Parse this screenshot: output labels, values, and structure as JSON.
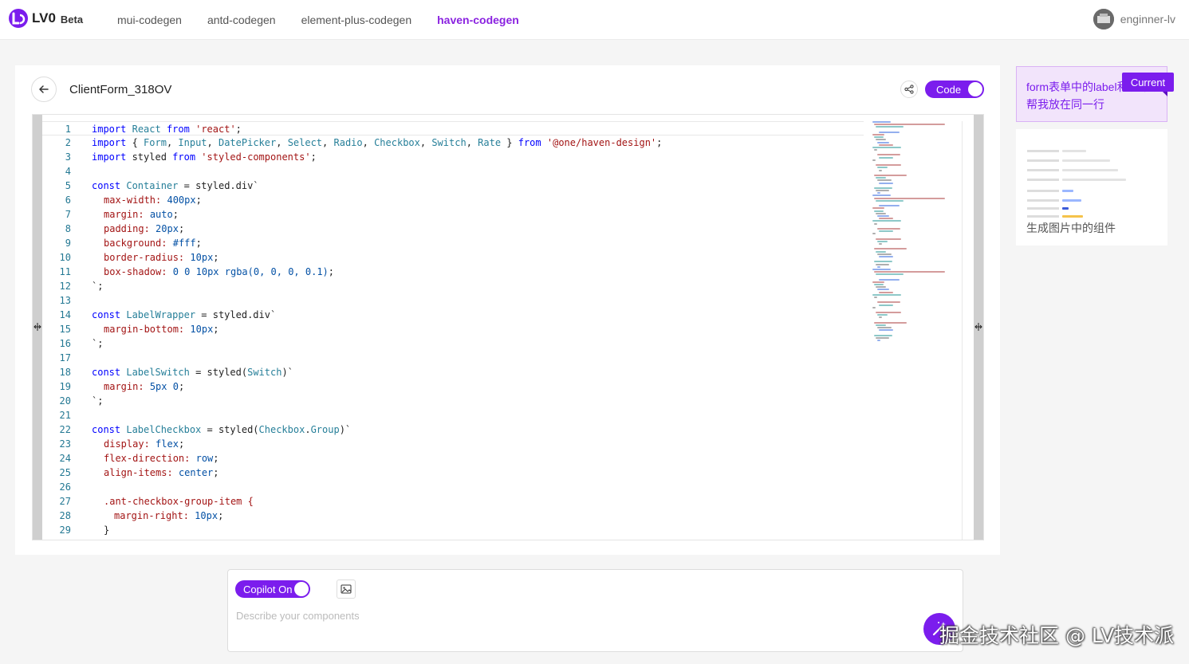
{
  "brand": {
    "name": "LV0",
    "badge": "Beta",
    "accent": "#7b1ded"
  },
  "nav": {
    "items": [
      {
        "label": "mui-codegen"
      },
      {
        "label": "antd-codegen"
      },
      {
        "label": "element-plus-codegen"
      },
      {
        "label": "haven-codegen",
        "active": true
      }
    ]
  },
  "user": {
    "name": "enginner-lv"
  },
  "editor": {
    "component_name": "ClientForm_318OV",
    "code_toggle_label": "Code",
    "lines": [
      {
        "n": "1",
        "text": "import React from 'react';"
      },
      {
        "n": "2",
        "text": "import { Form, Input, DatePicker, Select, Radio, Checkbox, Switch, Rate } from '@one/haven-design';"
      },
      {
        "n": "3",
        "text": "import styled from 'styled-components';"
      },
      {
        "n": "4",
        "text": ""
      },
      {
        "n": "5",
        "text": "const Container = styled.div`"
      },
      {
        "n": "6",
        "text": "max-width: 400px;"
      },
      {
        "n": "7",
        "text": "margin: auto;"
      },
      {
        "n": "8",
        "text": "padding: 20px;"
      },
      {
        "n": "9",
        "text": "background: #fff;"
      },
      {
        "n": "10",
        "text": "border-radius: 10px;"
      },
      {
        "n": "11",
        "text": "box-shadow: 0 0 10px rgba(0, 0, 0, 0.1);"
      },
      {
        "n": "12",
        "text": "`;"
      },
      {
        "n": "13",
        "text": ""
      },
      {
        "n": "14",
        "text": "const LabelWrapper = styled.div`"
      },
      {
        "n": "15",
        "text": "margin-bottom: 10px;"
      },
      {
        "n": "16",
        "text": "`;"
      },
      {
        "n": "17",
        "text": ""
      },
      {
        "n": "18",
        "text": "const LabelSwitch = styled(Switch)`"
      },
      {
        "n": "19",
        "text": "margin: 5px 0;"
      },
      {
        "n": "20",
        "text": "`;"
      },
      {
        "n": "21",
        "text": ""
      },
      {
        "n": "22",
        "text": "const LabelCheckbox = styled(Checkbox.Group)`"
      },
      {
        "n": "23",
        "text": "display: flex;"
      },
      {
        "n": "24",
        "text": "flex-direction: row;"
      },
      {
        "n": "25",
        "text": "align-items: center;"
      },
      {
        "n": "26",
        "text": ""
      },
      {
        "n": "27",
        "text": ".ant-checkbox-group-item {"
      },
      {
        "n": "28",
        "text": "margin-right: 10px;"
      },
      {
        "n": "29",
        "text": "}"
      }
    ]
  },
  "history": {
    "current_prompt": "form表单中的label和表单项帮我放在同一行",
    "current_tag": "Current",
    "items": [
      {
        "caption": "生成图片中的组件"
      }
    ]
  },
  "prompt": {
    "copilot_label": "Copilot On",
    "placeholder": "Describe your components",
    "value": ""
  },
  "watermark": "掘金技术社区 @ LV技术派"
}
